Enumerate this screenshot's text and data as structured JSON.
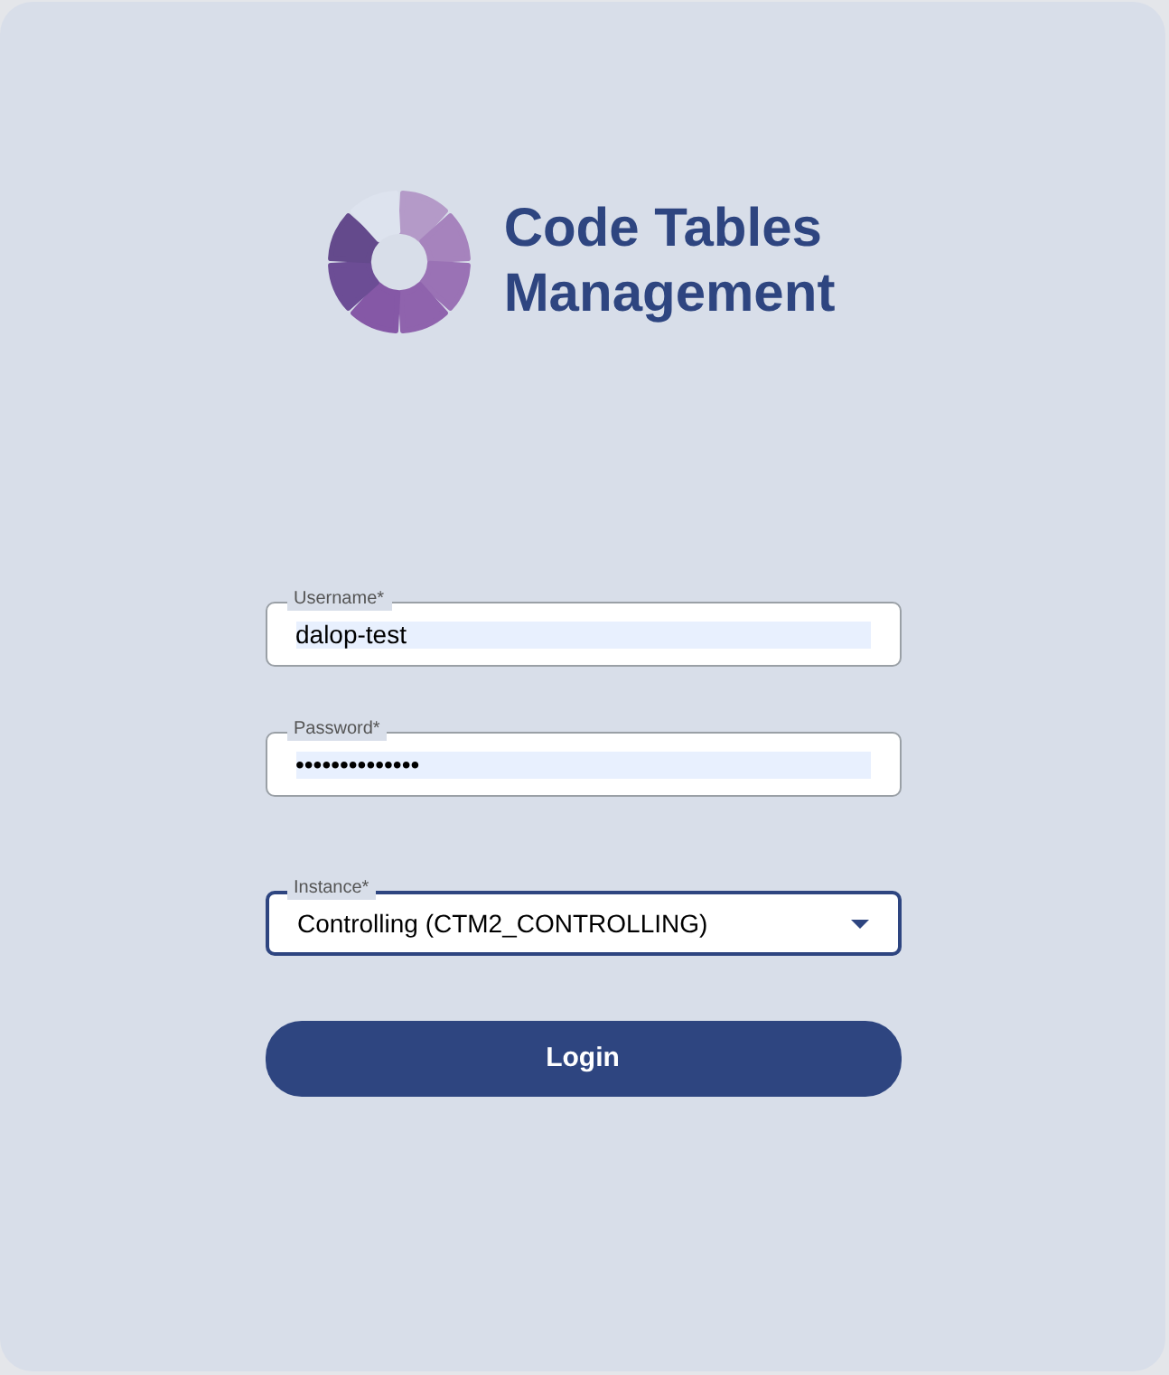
{
  "app": {
    "title_lines": [
      "Code Tables",
      "Management"
    ]
  },
  "fields": [
    {
      "kind": "text",
      "label": "Username*",
      "value": "dalop-test",
      "autofilled": true,
      "focused": false
    },
    {
      "kind": "password",
      "label": "Password*",
      "value": "••••••••••••••",
      "autofilled": true,
      "focused": false
    },
    {
      "kind": "select",
      "label": "Instance*",
      "value": "Controlling (CTM2_CONTROLLING)",
      "autofilled": false,
      "focused": true
    }
  ],
  "login_button": {
    "label": "Login"
  }
}
